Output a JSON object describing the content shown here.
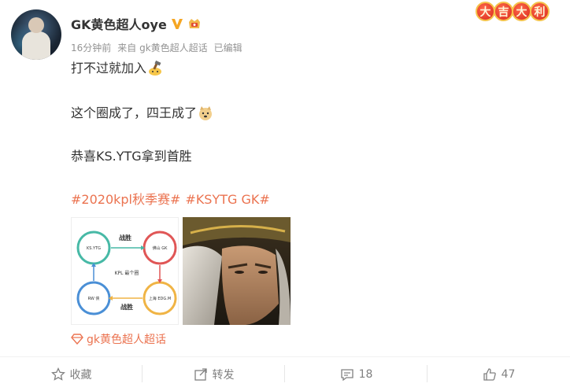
{
  "user": {
    "name": "GK黄色超人oye",
    "meta_time": "16分钟前",
    "meta_source": "来自 gk黄色超人超话",
    "meta_edited": "已编辑"
  },
  "festive_badge": [
    "大",
    "吉",
    "大",
    "利"
  ],
  "post": {
    "line1": "打不过就加入",
    "line2": "这个圈成了，四王成了",
    "line3": "恭喜KS.YTG拿到首胜",
    "hashtag1": "#2020kpl秋季赛#",
    "hashtag2": "#KSYTG GK#"
  },
  "diagram_image": {
    "node_top_left": "KS.YTG",
    "node_top_right": "佛山 GK",
    "node_bottom_left": "RW 侠",
    "node_bottom_right": "上海 EDG.M",
    "center_label": "KPL 最个圈",
    "win_label": "战胜"
  },
  "super_topic": {
    "label": "gk黄色超人超话"
  },
  "actions": {
    "favorite_label": "收藏",
    "repost_label": "转发",
    "comment_count": "18",
    "like_count": "47"
  },
  "colors": {
    "accent": "#eb7350",
    "meta": "#939393",
    "action": "#808080"
  }
}
